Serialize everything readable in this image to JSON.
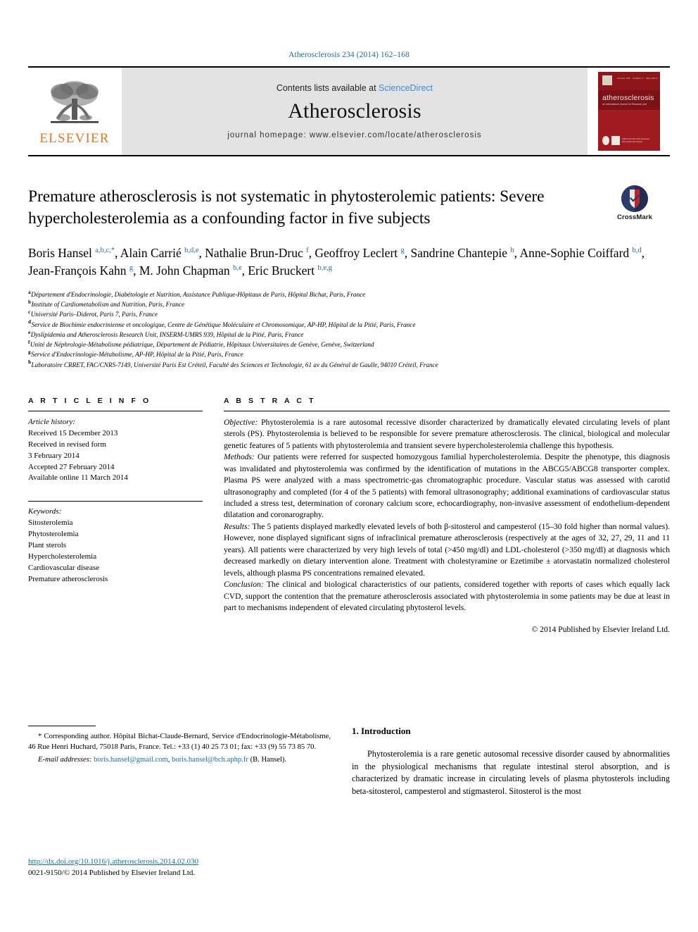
{
  "running_head": "Atherosclerosis 234 (2014) 162–168",
  "masthead": {
    "publisher_logo_name": "elsevier-tree-logo",
    "publisher_wordmark": "ELSEVIER",
    "contents_prefix": "Contents lists available at",
    "contents_link": "ScienceDirect",
    "journal_name": "Atherosclerosis",
    "homepage": "journal homepage: www.elsevier.com/locate/atherosclerosis",
    "cover": {
      "title": "atherosclerosis",
      "subtitle": "An International Journal for Research and",
      "topline": "Volume 234 · Number 1 · May 2014",
      "footer": "Official Journal of the European Atherosclerosis Society"
    }
  },
  "article": {
    "title": "Premature atherosclerosis is not systematic in phytosterolemic patients: Severe hypercholesterolemia as a confounding factor in five subjects",
    "crossmark_label": "CrossMark",
    "authors_html": "Boris Hansel <sup>a,b,c,</sup><sup class=\"star\">*</sup>, Alain Carrié <sup>b,d,e</sup>, Nathalie Brun-Druc <sup>f</sup>, Geoffroy Leclert <sup>g</sup>, Sandrine Chantepie <sup>h</sup>, Anne-Sophie Coiffard <sup>b,d</sup>, Jean-François Kahn <sup>g</sup>, M. John Chapman <sup>b,e</sup>, Eric Bruckert <sup>b,e,g</sup>",
    "affiliations": [
      {
        "mark": "a",
        "text": "Département d'Endocrinologie, Diabétologie et Nutrition, Assistance Publique-Hôpitaux de Paris, Hôpital Bichat, Paris, France"
      },
      {
        "mark": "b",
        "text": "Institute of Cardiometabolism and Nutrition, Paris, France"
      },
      {
        "mark": "c",
        "text": "Université Paris–Diderot, Paris 7, Paris, France"
      },
      {
        "mark": "d",
        "text": "Service de Biochimie endocrinienne et oncologique, Centre de Génétique Moléculaire et Chromosomique, AP-HP, Hôpital de la Pitié, Paris, France"
      },
      {
        "mark": "e",
        "text": "Dyslipidemia and Atherosclerosis Research Unit, INSERM-UMRS 939, Hôpital de la Pitié, Paris, France"
      },
      {
        "mark": "f",
        "text": "Unité de Néphrologie-Métabolisme pédiatrique, Département de Pédiatrie, Hôpitaux Universitaires de Genève, Genève, Switzerland"
      },
      {
        "mark": "g",
        "text": "Service d'Endocrinologie-Métabolisme, AP-HP, Hôpital de la Pitié, Paris, France"
      },
      {
        "mark": "h",
        "text": "Laboratoire CRRET, FAC/CNRS-7149, Université Paris Est Créteil, Faculté des Sciences et Technologie, 61 av du Général de Gaulle, 94010 Créteil, France"
      }
    ]
  },
  "article_info": {
    "heading": "A R T I C L E   I N F O",
    "history_label": "Article history:",
    "history": [
      "Received 15 December 2013",
      "Received in revised form",
      "3 February 2014",
      "Accepted 27 February 2014",
      "Available online 11 March 2014"
    ],
    "keywords_label": "Keywords:",
    "keywords": [
      "Sitosterolemia",
      "Phytosterolemia",
      "Plant sterols",
      "Hypercholesterolemia",
      "Cardiovascular disease",
      "Premature atherosclerosis"
    ]
  },
  "abstract": {
    "heading": "A B S T R A C T",
    "sections": [
      {
        "lead": "Objective:",
        "text": " Phytosterolemia is a rare autosomal recessive disorder characterized by dramatically elevated circulating levels of plant sterols (PS). Phytosterolemia is believed to be responsible for severe premature atherosclerosis. The clinical, biological and molecular genetic features of 5 patients with phytosterolemia and transient severe hypercholesterolemia challenge this hypothesis."
      },
      {
        "lead": "Methods:",
        "text": " Our patients were referred for suspected homozygous familial hypercholesterolemia. Despite the phenotype, this diagnosis was invalidated and phytosterolemia was confirmed by the identification of mutations in the ABCG5/ABCG8 transporter complex. Plasma PS were analyzed with a mass spectrometric-gas chromatographic procedure. Vascular status was assessed with carotid ultrasonography and completed (for 4 of the 5 patients) with femoral ultrasonography; additional examinations of cardiovascular status included a stress test, determination of coronary calcium score, echocardiography, non-invasive assessment of endothelium-dependent dilatation and coronarography."
      },
      {
        "lead": "Results:",
        "text": " The 5 patients displayed markedly elevated levels of both β-sitosterol and campesterol (15–30 fold higher than normal values). However, none displayed significant signs of infraclinical premature atherosclerosis (respectively at the ages of 32, 27, 29, 11 and 11 years). All patients were characterized by very high levels of total (>450 mg/dl) and LDL-cholesterol (>350 mg/dl) at diagnosis which decreased markedly on dietary intervention alone. Treatment with cholestyramine or Ezetimibe ± atorvastatin normalized cholesterol levels, although plasma PS concentrations remained elevated."
      },
      {
        "lead": "Conclusion:",
        "text": " The clinical and biological characteristics of our patients, considered together with reports of cases which equally lack CVD, support the contention that the premature atherosclerosis associated with phytosterolemia in some patients may be due at least in part to mechanisms independent of elevated circulating phytosterol levels."
      }
    ],
    "copyright": "© 2014 Published by Elsevier Ireland Ltd."
  },
  "footnotes": {
    "corresponding": "* Corresponding author. Hôpital Bichat-Claude-Bernard, Service d'Endocrinologie-Métabolisme, 46 Rue Henri Huchard, 75018 Paris, France. Tel.: +33 (1) 40 25 73 01; fax: +33 (9) 55 73 85 70.",
    "email_label": "E-mail addresses:",
    "email_1": "boris.hansel@gmail.com",
    "email_2": "boris.hansel@bch.aphp.fr",
    "email_suffix": "(B. Hansel).",
    "doi": "http://dx.doi.org/10.1016/j.atherosclerosis.2014.02.030",
    "issn_line": "0021-9150/© 2014 Published by Elsevier Ireland Ltd."
  },
  "introduction": {
    "heading": "1. Introduction",
    "paragraph": "Phytosterolemia is a rare genetic autosomal recessive disorder caused by abnormalities in the physiological mechanisms that regulate intestinal sterol absorption, and is characterized by dramatic increase in circulating levels of plasma phytosterols including beta-sitosterol, campesterol and stigmasterol. Sitosterol is the most"
  },
  "colors": {
    "link_blue": "#1b6ca8",
    "sciencedirect_blue": "#3b8fd4",
    "elsevier_orange": "#e87722",
    "cover_red": "#a01b20"
  }
}
